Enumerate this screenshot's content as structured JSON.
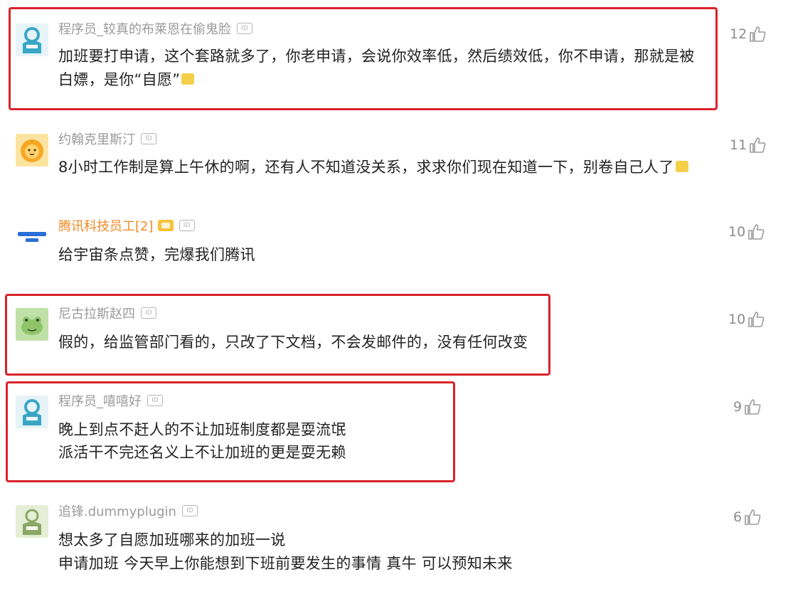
{
  "comments": [
    {
      "username": "程序员_较真的布莱恩在偷鬼脸",
      "lines": [
        "加班要打申请，这个套路就多了，你老申请，会说你效率低，然后绩效低，你不申请，那就是被",
        "白嫖，是你“自愿”"
      ],
      "likes": "12",
      "avatar_icon": "programmer-avatar-icon"
    },
    {
      "username": "约翰克里斯汀",
      "lines": [
        "8小时工作制是算上午休的啊，还有人不知道没关系，求求你们现在知道一下，别卷自己人了"
      ],
      "likes": "11",
      "avatar_icon": "lion-avatar-icon"
    },
    {
      "username": "腾讯科技员工[2]",
      "lines": [
        "给宇宙条点赞，完爆我们腾讯"
      ],
      "likes": "10",
      "avatar_icon": "tencent-logo-avatar-icon"
    },
    {
      "username": "尼古拉斯赵四",
      "lines": [
        "假的，给监管部门看的，只改了下文档，不会发邮件的，没有任何改变"
      ],
      "likes": "10",
      "avatar_icon": "frog-avatar-icon"
    },
    {
      "username": "程序员_嘻嘻好",
      "lines": [
        "晚上到点不赶人的不让加班制度都是耍流氓",
        "派活干不完还名义上不让加班的更是耍无赖"
      ],
      "likes": "9",
      "avatar_icon": "programmer-avatar-icon"
    },
    {
      "username": "追锋.dummyplugin",
      "lines": [
        "想太多了自愿加班哪来的加班一说",
        "申请加班 今天早上你能想到下班前要发生的事情 真牛 可以预知未来"
      ],
      "likes": "6",
      "avatar_icon": "apron-avatar-icon"
    }
  ],
  "colors": {
    "highlight_box": "#d9222a",
    "username": "#9a9a9a",
    "username_vip": "#f08a24",
    "text": "#222222",
    "like_count": "#8c8c8c"
  },
  "icons": {
    "id_badge": "id-badge-icon",
    "like": "thumbs-up-icon",
    "vip": "vip-badge-icon",
    "emoji": "emoji-icon"
  }
}
